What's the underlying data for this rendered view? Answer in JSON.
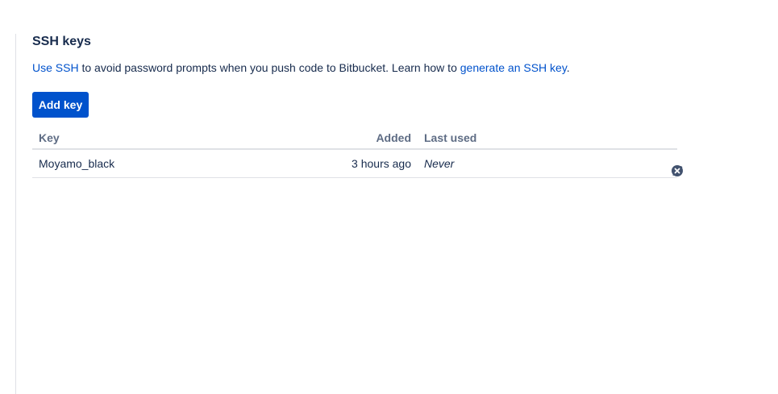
{
  "section": {
    "title": "SSH keys",
    "desc_link1": "Use SSH",
    "desc_mid": " to avoid password prompts when you push code to Bitbucket. Learn how to ",
    "desc_link2": "generate an SSH key",
    "desc_end": "."
  },
  "add_button_label": "Add key",
  "table": {
    "headers": {
      "key": "Key",
      "added": "Added",
      "last_used": "Last used"
    },
    "rows": [
      {
        "key": "Moyamo_black",
        "added": "3 hours ago",
        "last_used": "Never"
      }
    ]
  },
  "icons": {
    "edit": "pencil-icon",
    "delete": "close-circle-icon"
  },
  "colors": {
    "accent": "#0052cc",
    "text": "#172b4d",
    "muted": "#5e6c84",
    "border": "#dfe1e6"
  }
}
